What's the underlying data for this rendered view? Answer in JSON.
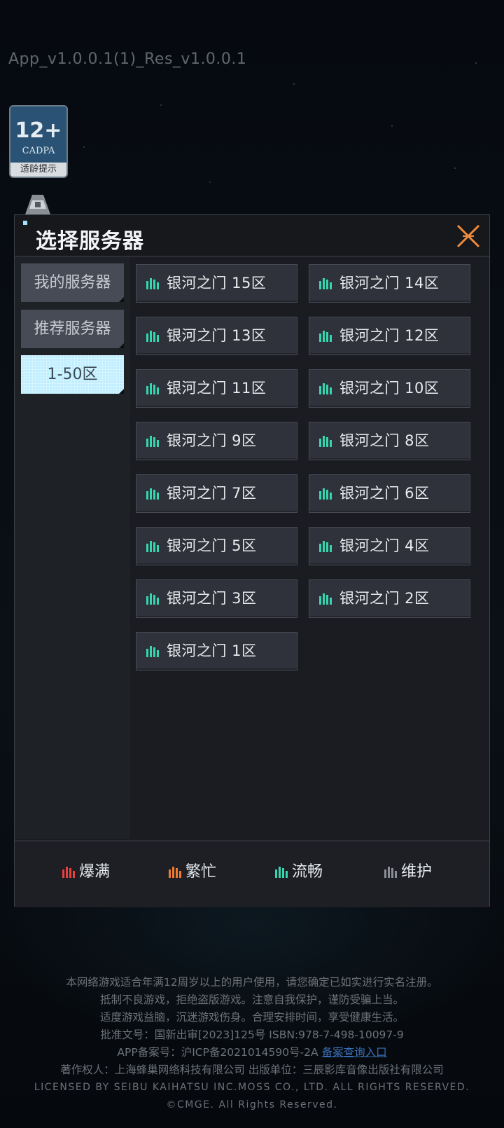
{
  "version_label": "App_v1.0.0.1(1)_Res_v1.0.0.1",
  "age_badge": {
    "age": "12+",
    "org": "CADPA",
    "tip": "适龄提示"
  },
  "dialog": {
    "title": "选择服务器",
    "tabs": [
      {
        "label": "我的服务器",
        "active": false
      },
      {
        "label": "推荐服务器",
        "active": false
      },
      {
        "label": "1-50区",
        "active": true
      }
    ],
    "servers": [
      {
        "name": "银河之门 15区",
        "status": "smooth"
      },
      {
        "name": "银河之门 14区",
        "status": "smooth"
      },
      {
        "name": "银河之门 13区",
        "status": "smooth"
      },
      {
        "name": "银河之门 12区",
        "status": "smooth"
      },
      {
        "name": "银河之门 11区",
        "status": "smooth"
      },
      {
        "name": "银河之门 10区",
        "status": "smooth"
      },
      {
        "name": "银河之门 9区",
        "status": "smooth"
      },
      {
        "name": "银河之门 8区",
        "status": "smooth"
      },
      {
        "name": "银河之门 7区",
        "status": "smooth"
      },
      {
        "name": "银河之门 6区",
        "status": "smooth"
      },
      {
        "name": "银河之门 5区",
        "status": "smooth"
      },
      {
        "name": "银河之门 4区",
        "status": "smooth"
      },
      {
        "name": "银河之门 3区",
        "status": "smooth"
      },
      {
        "name": "银河之门 2区",
        "status": "smooth"
      },
      {
        "name": "银河之门 1区",
        "status": "smooth"
      }
    ],
    "legend": [
      {
        "label": "爆满",
        "color": "#e8403c"
      },
      {
        "label": "繁忙",
        "color": "#f07a32"
      },
      {
        "label": "流畅",
        "color": "#35d6b0"
      },
      {
        "label": "维护",
        "color": "#8a8e94"
      }
    ]
  },
  "footer": {
    "line1": "本网络游戏适合年满12周岁以上的用户使用，请您确定已如实进行实名注册。",
    "line2": "抵制不良游戏，拒绝盗版游戏。注意自我保护，谨防受骗上当。",
    "line3": "适度游戏益脑，沉迷游戏伤身。合理安排时间，享受健康生活。",
    "line4": "批准文号：国新出审[2023]125号 ISBN:978-7-498-10097-9",
    "line5_prefix": "APP备案号：沪ICP备2021014590号-2A",
    "line5_link": "备案查询入口",
    "line6": "著作权人：上海蜂巢网络科技有限公司 出版单位：三辰影库音像出版社有限公司",
    "line7": "LICENSED BY SEIBU KAIHATSU INC.MOSS CO., LTD. ALL RIGHTS RESERVED.",
    "line8": "©CMGE. All Rights Reserved."
  }
}
